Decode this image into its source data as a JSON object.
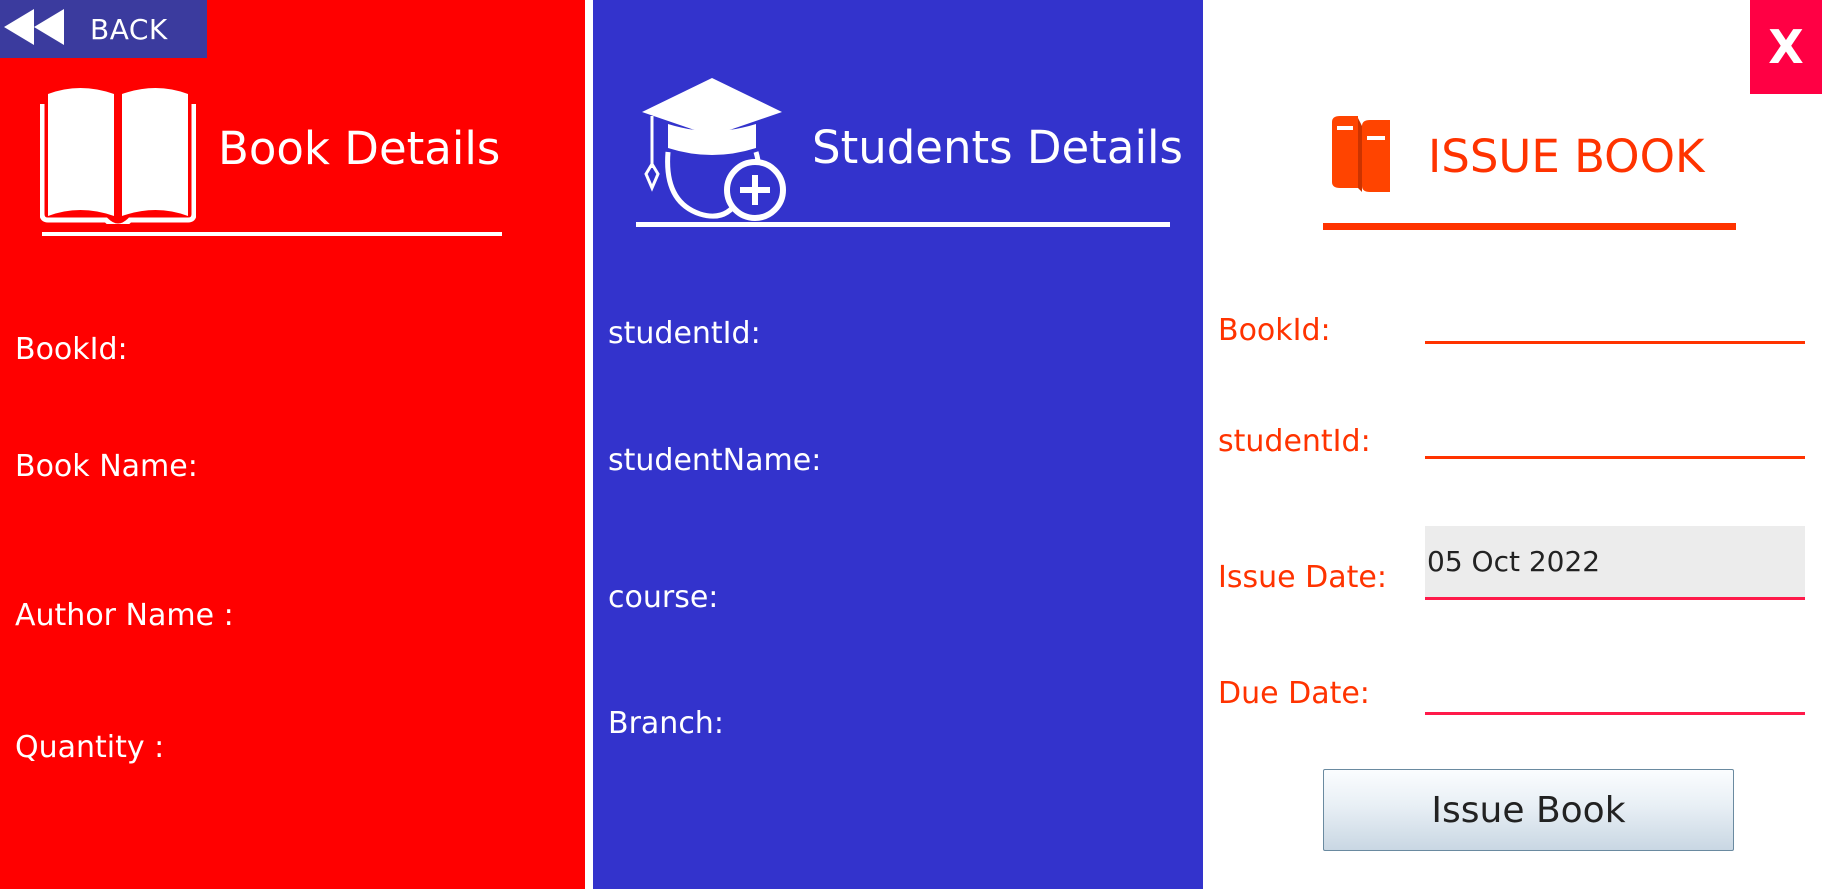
{
  "nav": {
    "back_label": "BACK",
    "close_label": "X"
  },
  "book_details": {
    "title": "Book Details",
    "fields": [
      {
        "label": "BookId:"
      },
      {
        "label": "Book Name:"
      },
      {
        "label": "Author Name :"
      },
      {
        "label": "Quantity :"
      }
    ]
  },
  "student_details": {
    "title": "Students Details",
    "fields": [
      {
        "label": "studentId:"
      },
      {
        "label": "studentName:"
      },
      {
        "label": "course:"
      },
      {
        "label": "Branch:"
      }
    ]
  },
  "issue_book": {
    "title": "ISSUE BOOK",
    "book_id_label": "BookId:",
    "book_id_value": "",
    "student_id_label": "studentId:",
    "student_id_value": "",
    "issue_date_label": "Issue Date:",
    "issue_date_value": "05 Oct 2022",
    "due_date_label": "Due Date:",
    "due_date_value": "",
    "button_label": "Issue Book"
  },
  "colors": {
    "book_panel": "#ff0000",
    "student_panel": "#3333cc",
    "accent": "#ff3300",
    "close_button": "#ff0044",
    "back_button": "#3b3b9e"
  },
  "icons": {
    "back": "rewind-icon",
    "book": "open-book-icon",
    "student": "graduate-add-icon",
    "issue": "books-icon"
  }
}
